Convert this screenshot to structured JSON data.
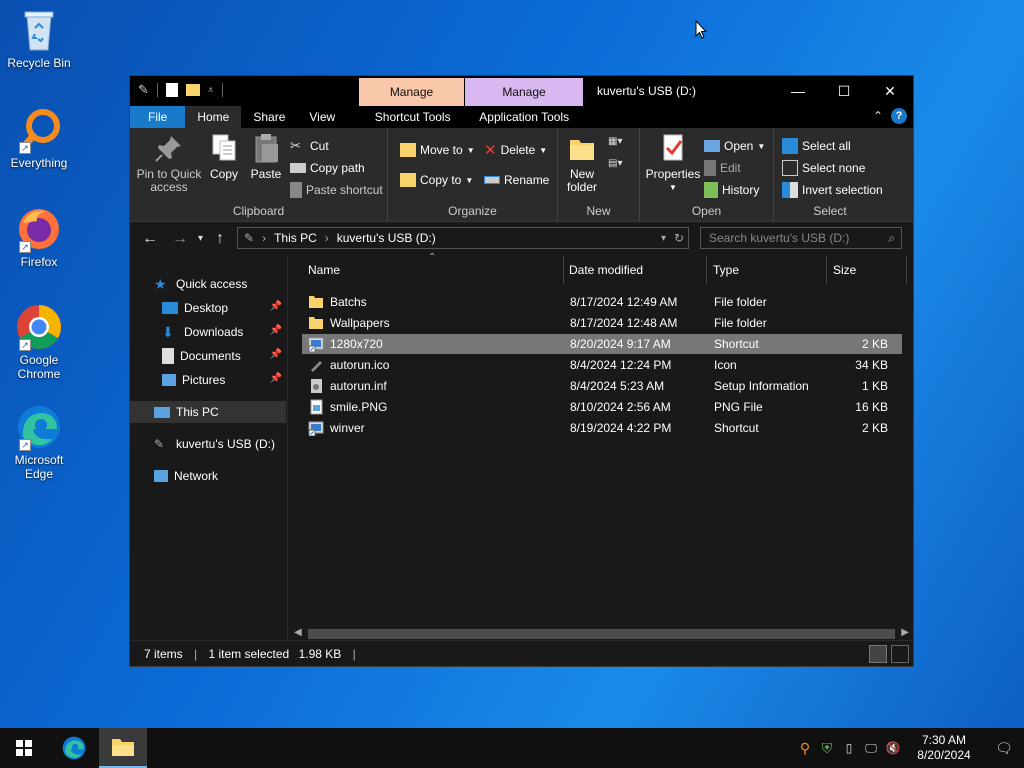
{
  "desktop": {
    "icons": [
      {
        "label": "Recycle Bin",
        "icon": "recycle-bin-icon"
      },
      {
        "label": "Everything",
        "icon": "everything-search-icon"
      },
      {
        "label": "Firefox",
        "icon": "firefox-icon"
      },
      {
        "label": "Google Chrome",
        "icon": "chrome-icon"
      },
      {
        "label": "Microsoft Edge",
        "icon": "edge-icon"
      }
    ]
  },
  "window": {
    "title": "kuvertu's USB (D:)",
    "context_tab_1": "Manage",
    "context_tab_2": "Manage",
    "tabs": {
      "file": "File",
      "home": "Home",
      "share": "Share",
      "view": "View",
      "shortcut_tools": "Shortcut Tools",
      "application_tools": "Application Tools"
    }
  },
  "ribbon": {
    "clipboard": {
      "label": "Clipboard",
      "pin": "Pin to Quick access",
      "copy": "Copy",
      "paste": "Paste",
      "cut": "Cut",
      "copy_path": "Copy path",
      "paste_shortcut": "Paste shortcut"
    },
    "organize": {
      "label": "Organize",
      "move_to": "Move to",
      "copy_to": "Copy to",
      "delete": "Delete",
      "rename": "Rename"
    },
    "new": {
      "label": "New",
      "new_folder": "New folder"
    },
    "open": {
      "label": "Open",
      "properties": "Properties",
      "open": "Open",
      "edit": "Edit",
      "history": "History"
    },
    "select": {
      "label": "Select",
      "select_all": "Select all",
      "select_none": "Select none",
      "invert": "Invert selection"
    }
  },
  "address": {
    "crumbs": [
      "This PC",
      "kuvertu's USB (D:)"
    ],
    "search_placeholder": "Search kuvertu's USB (D:)"
  },
  "nav": {
    "quick_access": "Quick access",
    "desktop": "Desktop",
    "downloads": "Downloads",
    "documents": "Documents",
    "pictures": "Pictures",
    "this_pc": "This PC",
    "usb": "kuvertu's USB (D:)",
    "network": "Network"
  },
  "columns": {
    "name": "Name",
    "date": "Date modified",
    "type": "Type",
    "size": "Size"
  },
  "files": [
    {
      "name": "Batchs",
      "date": "8/17/2024 12:49 AM",
      "type": "File folder",
      "size": "",
      "icon": "folder-icon"
    },
    {
      "name": "Wallpapers",
      "date": "8/17/2024 12:48 AM",
      "type": "File folder",
      "size": "",
      "icon": "folder-icon"
    },
    {
      "name": "1280x720",
      "date": "8/20/2024 9:17 AM",
      "type": "Shortcut",
      "size": "2 KB",
      "icon": "shortcut-icon"
    },
    {
      "name": "autorun.ico",
      "date": "8/4/2024 12:24 PM",
      "type": "Icon",
      "size": "34 KB",
      "icon": "usb-ico-icon"
    },
    {
      "name": "autorun.inf",
      "date": "8/4/2024 5:23 AM",
      "type": "Setup Information",
      "size": "1 KB",
      "icon": "setup-file-icon"
    },
    {
      "name": "smile.PNG",
      "date": "8/10/2024 2:56 AM",
      "type": "PNG File",
      "size": "16 KB",
      "icon": "image-file-icon"
    },
    {
      "name": "winver",
      "date": "8/19/2024 4:22 PM",
      "type": "Shortcut",
      "size": "2 KB",
      "icon": "shortcut-icon"
    }
  ],
  "selected_index": 2,
  "status": {
    "items": "7 items",
    "selected": "1 item selected",
    "size": "1.98 KB"
  },
  "taskbar": {
    "time": "7:30 AM",
    "date": "8/20/2024"
  },
  "colors": {
    "accent": "#1979ca",
    "manage_shortcut": "#f9c7a9",
    "manage_app": "#d9b8f2",
    "selection": "#777777"
  }
}
